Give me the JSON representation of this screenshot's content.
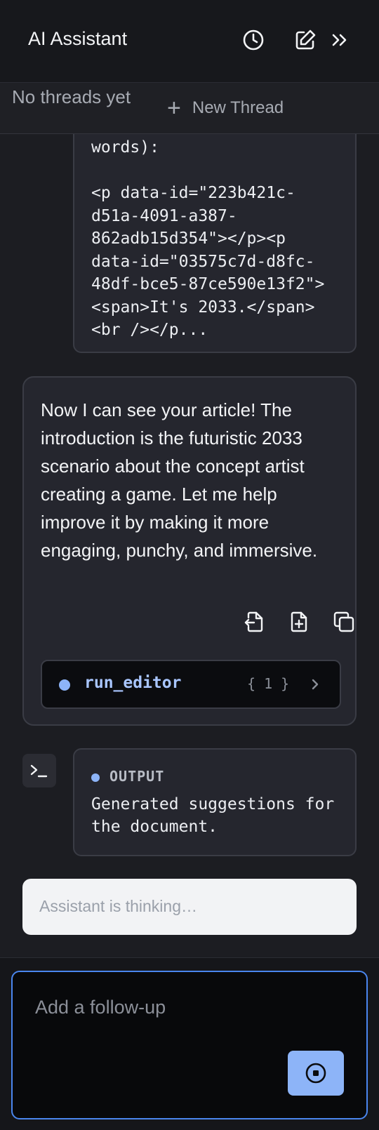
{
  "header": {
    "title": "AI Assistant",
    "icons": [
      "history-icon",
      "edit-icon",
      "double-chevron-right-icon"
    ]
  },
  "threads": {
    "empty_text": "No threads yet",
    "new_thread_label": "New Thread",
    "new_thread_icon": "+"
  },
  "code_block": {
    "text": "words):\n\n<p data-id=\"223b421c-\nd51a-4091-a387-\n862adb15d354\"></p><p\ndata-id=\"03575c7d-d8fc-\n48df-bce5-87ce590e13f2\">\n<span>It's 2033.</span>\n<br /></p..."
  },
  "assistant_message": {
    "text": "Now I can see your article! The introduction is the futuristic 2033 scenario about the concept artist creating a game. Let me help improve it by making it more engaging, punchy, and immersive.",
    "actions": [
      "export-icon",
      "add-file-icon",
      "copy-icon"
    ]
  },
  "tool_call": {
    "name": "run_editor",
    "args_badge": "{ 1 }"
  },
  "tool_output": {
    "label": "OUTPUT",
    "text": "Generated suggestions for the document."
  },
  "status": {
    "thinking_text": "Assistant is thinking…"
  },
  "composer": {
    "placeholder": "Add a follow-up",
    "value": ""
  },
  "colors": {
    "accent": "#8db4f8",
    "focus_border": "#4a86ee",
    "background": "#1c1d22",
    "card": "#25262e"
  }
}
